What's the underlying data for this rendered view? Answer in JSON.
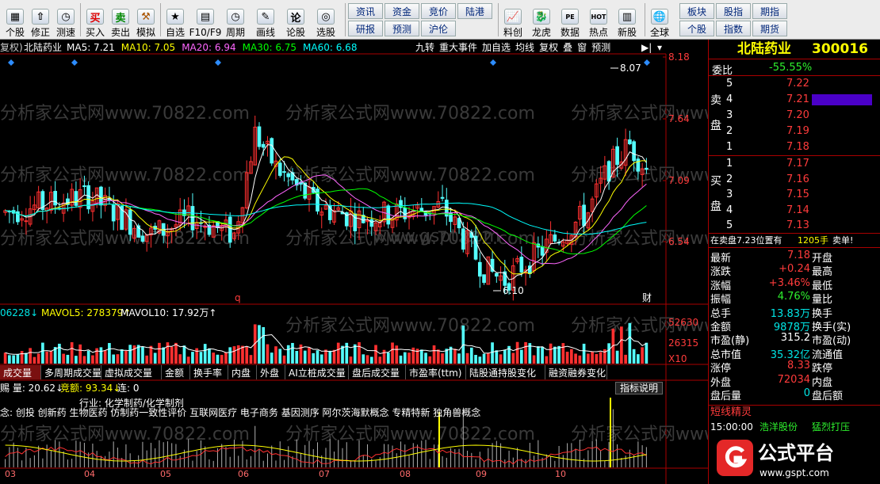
{
  "toolbar": {
    "left_buttons": [
      {
        "label": "个股",
        "icon": "grid-icon"
      },
      {
        "label": "修正",
        "icon": "up-arrow-icon"
      },
      {
        "label": "测速",
        "icon": "clock-icon"
      }
    ],
    "trade_buttons": [
      {
        "label": "买入",
        "glyph": "买"
      },
      {
        "label": "卖出",
        "glyph": "卖"
      },
      {
        "label": "模拟",
        "glyph": "⚒"
      }
    ],
    "view_buttons": [
      {
        "label": "自选",
        "glyph": "★"
      },
      {
        "label": "F10/F9",
        "glyph": "▤"
      },
      {
        "label": "周期",
        "glyph": "◷"
      },
      {
        "label": "画线",
        "glyph": "✎"
      },
      {
        "label": "论股",
        "glyph": "论"
      },
      {
        "label": "选股",
        "glyph": "◎"
      }
    ],
    "small_buttons_top": [
      "资讯",
      "资金",
      "竞价",
      "陆港"
    ],
    "small_buttons_bottom": [
      "研报",
      "预测",
      "沪伦"
    ],
    "tool_buttons": [
      {
        "label": "料创",
        "glyph": "📈"
      },
      {
        "label": "龙虎",
        "glyph": "🐉"
      },
      {
        "label": "数据",
        "glyph": "PE"
      },
      {
        "label": "热点",
        "glyph": "HOT"
      },
      {
        "label": "新股",
        "glyph": "▥"
      }
    ],
    "global_button": {
      "label": "全球",
      "glyph": "🌐"
    },
    "right_small_top": [
      "板块",
      "股指",
      "期指"
    ],
    "right_small_bottom": [
      "个股",
      "指数",
      "期货"
    ]
  },
  "chart": {
    "header_prefix": "复权)",
    "stock_name": "北陆药业",
    "ma": [
      {
        "label": "MA5: 7.21",
        "color": "#ffffff"
      },
      {
        "label": "MA10: 7.05",
        "color": "#ffff00"
      },
      {
        "label": "MA20: 6.94",
        "color": "#ff66ff"
      },
      {
        "label": "MA30: 6.75",
        "color": "#00ff00"
      },
      {
        "label": "MA60: 6.68",
        "color": "#00ffff"
      }
    ],
    "right_menu": [
      "九转",
      "重大事件",
      "加自选",
      "均线",
      "复权",
      "叠",
      "窗",
      "预测"
    ],
    "price_axis": [
      "8.18",
      "7.64",
      "7.09",
      "6.54"
    ],
    "high_label": "8.07",
    "low_label": "6.10",
    "marker_q": "q",
    "marker_cai": "财",
    "watermark": "分析家公式网www.70822.com",
    "watermark2": "www.gspt.com",
    "volume_header": {
      "v1": "06228↓",
      "v2": "MAVOL5: 278379↑",
      "v3": "MAVOL10: 17.92万↑"
    },
    "volume_axis": [
      "52630",
      "26315",
      "X10"
    ],
    "tabs": [
      "成交量",
      "多周期成交量",
      "虚拟成交量",
      "金额",
      "换手率",
      "内盘",
      "外盘",
      "AI立桩成交量",
      "盘后成交量",
      "市盈率(ttm)",
      "陆股通持股变化",
      "融资融券变化"
    ],
    "indicator_header": {
      "a": "赐 量: 20.62↓",
      "b": "竞额: 93.34↓",
      "c": "连: 0"
    },
    "indicator_button": "指标说明",
    "industry": "行业: 化学制药/化学制剂",
    "concepts": "念: 创投  创新药  生物医药  仿制药一致性评价  互联网医疗  电子商务  基因测序  阿尔茨海默概念  专精特新  独角兽概念",
    "months": [
      "03",
      "04",
      "05",
      "06",
      "07",
      "08",
      "09",
      "10"
    ]
  },
  "side": {
    "title": "北陆药业",
    "code": "300016",
    "weibi_label": "委比",
    "weibi_value": "-55.55%",
    "sell_label": [
      "卖",
      "盘"
    ],
    "buy_label": [
      "买",
      "盘"
    ],
    "sells": [
      {
        "n": "5",
        "p": "7.22"
      },
      {
        "n": "4",
        "p": "7.21"
      },
      {
        "n": "3",
        "p": "7.20"
      },
      {
        "n": "2",
        "p": "7.19"
      },
      {
        "n": "1",
        "p": "7.18"
      }
    ],
    "buys": [
      {
        "n": "1",
        "p": "7.17"
      },
      {
        "n": "2",
        "p": "7.16"
      },
      {
        "n": "3",
        "p": "7.15"
      },
      {
        "n": "4",
        "p": "7.14"
      },
      {
        "n": "5",
        "p": "7.13"
      }
    ],
    "notice_a": "在卖盘7.23位置有",
    "notice_b": "1205手",
    "notice_c": "卖单!",
    "stats": [
      {
        "l": "最新",
        "v": "7.18",
        "r": "开盘",
        "c": "red"
      },
      {
        "l": "涨跌",
        "v": "+0.24",
        "r": "最高",
        "c": "red"
      },
      {
        "l": "涨幅",
        "v": "+3.46%",
        "r": "最低",
        "c": "red"
      },
      {
        "l": "振幅",
        "v": "4.76%",
        "r": "量比",
        "c": "grn"
      },
      {
        "l": "总手",
        "v": "13.83万",
        "r": "换手",
        "c": "cyn"
      },
      {
        "l": "金额",
        "v": "9878万",
        "r": "换手(实)",
        "c": "cyn"
      },
      {
        "l": "市盈(静)",
        "v": "315.2",
        "r": "市盈(动)",
        "c": "wt"
      },
      {
        "l": "总市值",
        "v": "35.32亿",
        "r": "流通值",
        "c": "cyn"
      },
      {
        "l": "涨停",
        "v": "8.33",
        "r": "跌停",
        "c": "red"
      },
      {
        "l": "外盘",
        "v": "72034",
        "r": "内盘",
        "c": "red"
      },
      {
        "l": "盘后量",
        "v": "0",
        "r": "盘后额",
        "c": "cyn"
      }
    ],
    "sprite_title": "短线精灵",
    "sprite_time": "15:00:00",
    "sprite_stock": "浩洋股份",
    "sprite_event": "猛烈打压",
    "logo_text": "公式平台",
    "logo_url": "www.gspt.com"
  }
}
